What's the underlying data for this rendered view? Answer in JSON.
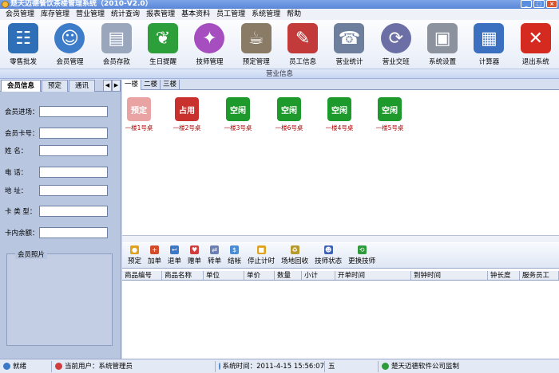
{
  "window": {
    "title": "楚天迈德餐饮茶楼管理系统（2010-V2.0）"
  },
  "menu": [
    "会员管理",
    "库存管理",
    "营业管理",
    "统计查询",
    "报表管理",
    "基本资料",
    "员工管理",
    "系统管理",
    "帮助"
  ],
  "toolbar": [
    {
      "label": "零售批发",
      "icon": "user-group-icon",
      "color": "#2f6fb8"
    },
    {
      "label": "会员管理",
      "icon": "members-icon",
      "color": "#3d7cc9"
    },
    {
      "label": "会员存款",
      "icon": "deposit-icon",
      "color": "#9aa6bb"
    },
    {
      "label": "生日提醒",
      "icon": "leaf-icon",
      "color": "#2c9e3a"
    },
    {
      "label": "技师管理",
      "icon": "technician-icon",
      "color": "#a64ec0"
    },
    {
      "label": "预定管理",
      "icon": "cup-icon",
      "color": "#8a7b66"
    },
    {
      "label": "员工信息",
      "icon": "staff-icon",
      "color": "#c23a3a"
    },
    {
      "label": "营业统计",
      "icon": "fax-icon",
      "color": "#6d7f9c"
    },
    {
      "label": "营业交班",
      "icon": "shift-icon",
      "color": "#6c6fa6"
    },
    {
      "label": "系统设置",
      "icon": "computer-icon",
      "color": "#8c939f"
    },
    {
      "label": "计算器",
      "icon": "notepad-icon",
      "color": "#3b70c1"
    },
    {
      "label": "退出系统",
      "icon": "exit-icon",
      "color": "#d42a1f"
    }
  ],
  "section_title": "营业信息",
  "left_tabs": [
    "会员信息",
    "预定",
    "通讯"
  ],
  "member_form": [
    {
      "label": "会员进场："
    },
    {
      "label": "会员卡号："
    },
    {
      "label": "姓    名："
    },
    {
      "label": "电    话："
    },
    {
      "label": "地    址："
    },
    {
      "label": "卡 类 型："
    },
    {
      "label": "卡内余额："
    }
  ],
  "photo_label": "会员照片",
  "floor_tabs": [
    "一楼",
    "二楼",
    "三楼"
  ],
  "desks": [
    {
      "status": "预定",
      "name": "一楼1号桌",
      "color": "#e9a3a3"
    },
    {
      "status": "占用",
      "name": "一楼2号桌",
      "color": "#c9312f"
    },
    {
      "status": "空闲",
      "name": "一楼3号桌",
      "color": "#1e9a2c"
    },
    {
      "status": "空闲",
      "name": "一楼6号桌",
      "color": "#1e9a2c"
    },
    {
      "status": "空闲",
      "name": "一楼4号桌",
      "color": "#1e9a2c"
    },
    {
      "status": "空闲",
      "name": "一楼5号桌",
      "color": "#1e9a2c"
    }
  ],
  "actions": [
    {
      "label": "预定",
      "icon": "reserve-icon",
      "color": "#e0a21a"
    },
    {
      "label": "加单",
      "icon": "add-order-icon",
      "color": "#d24b2a"
    },
    {
      "label": "退单",
      "icon": "return-order-icon",
      "color": "#3b78c7"
    },
    {
      "label": "赠单",
      "icon": "gift-icon",
      "color": "#d13c3c"
    },
    {
      "label": "转单",
      "icon": "transfer-icon",
      "color": "#6a7fb5"
    },
    {
      "label": "结帐",
      "icon": "checkout-icon",
      "color": "#4b8bd1"
    },
    {
      "label": "停止计时",
      "icon": "stop-timer-icon",
      "color": "#e0a21a"
    },
    {
      "label": "场地回收",
      "icon": "recycle-icon",
      "color": "#b79a2c"
    },
    {
      "label": "技师状态",
      "icon": "tech-status-icon",
      "color": "#3d62b5"
    },
    {
      "label": "更换技师",
      "icon": "change-tech-icon",
      "color": "#2e9a3b"
    }
  ],
  "grid_columns": [
    "商品编号",
    "商品名称",
    "单位",
    "单价",
    "数量",
    "小计",
    "开单时间",
    "到钟时间",
    "钟长度",
    "服务员工"
  ],
  "status": {
    "ready": "就绪",
    "user": "当前用户：系统管理员",
    "time": "系统时间：2011-4-15 15:56:07",
    "weekday": "五",
    "company": "楚天迈德软件公司监制"
  }
}
